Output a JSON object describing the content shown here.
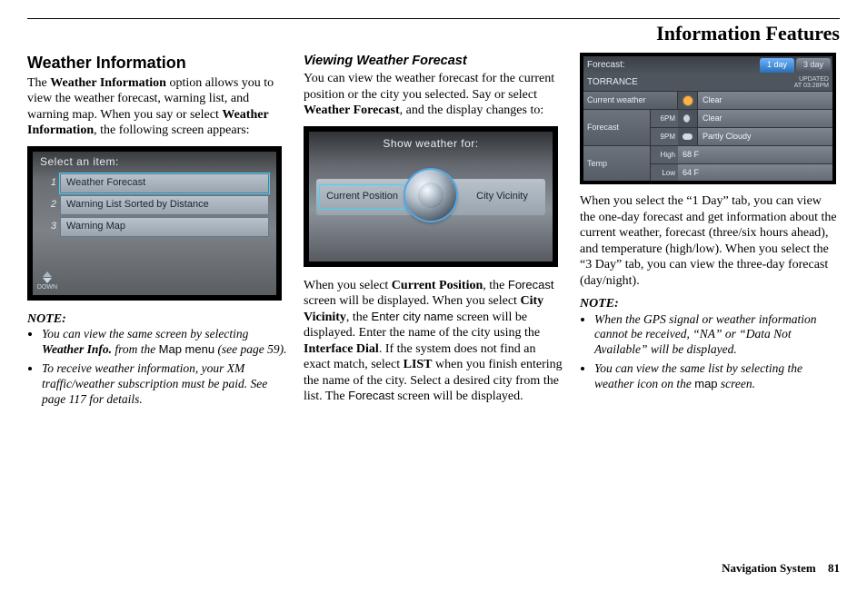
{
  "header": {
    "title": "Information Features"
  },
  "footer": {
    "label": "Navigation System",
    "page": "81"
  },
  "col1": {
    "heading": "Weather Information",
    "p1_a": "The ",
    "p1_b": "Weather Information",
    "p1_c": " option allows you to view the weather forecast, warning list, and warning map. When you say or select ",
    "p1_d": "Weather Information",
    "p1_e": ", the following screen appears:",
    "shot": {
      "title": "Select an item:",
      "r1": "Weather Forecast",
      "r2": "Warning List Sorted by Distance",
      "r3": "Warning Map",
      "down": "DOWN"
    },
    "note_label": "NOTE:",
    "notes": [
      {
        "a": "You can view the same screen by selecting ",
        "b": "Weather Info.",
        "c": " from the ",
        "d": "Map menu",
        "e": " (see page 59)."
      },
      {
        "a": "To receive weather information, your XM traffic/weather subscription must be paid. See page 117 for details."
      }
    ]
  },
  "col2": {
    "heading": "Viewing Weather Forecast",
    "p1_a": "You can view the weather forecast for the current position or the city you selected. Say or select ",
    "p1_b": "Weather Forecast",
    "p1_c": ", and the display changes to:",
    "shot": {
      "title": "Show weather for:",
      "left": "Current Position",
      "right": "City Vicinity"
    },
    "p2_a": "When you select ",
    "p2_b": "Current Position",
    "p2_c": ", the ",
    "p2_d": "Forecast",
    "p2_e": " screen will be displayed. When you select ",
    "p2_f": "City Vicinity",
    "p2_g": ", the ",
    "p2_h": "Enter city name",
    "p2_i": " screen will be displayed. Enter the name of the city using the ",
    "p2_j": "Interface Dial",
    "p2_k": ". If the system does not find an exact match, select ",
    "p2_l": "LIST",
    "p2_m": " when you finish entering the name of the city. Select a desired city from the list. The ",
    "p2_n": "Forecast",
    "p2_o": " screen will be displayed."
  },
  "col3": {
    "shot": {
      "title": "Forecast:",
      "tab1": "1 day",
      "tab2": "3 day",
      "city": "TORRANCE",
      "updated1": "UPDATED",
      "updated2": "AT 03:28PM",
      "row_cw_label": "Current weather",
      "row_cw_val": "Clear",
      "row_fc_label": "Forecast",
      "row_fc_t1": "6PM",
      "row_fc_v1": "Clear",
      "row_fc_t2": "9PM",
      "row_fc_v2": "Partly Cloudy",
      "row_tmp_label": "Temp",
      "row_tmp_h": "High",
      "row_tmp_hv": "68 F",
      "row_tmp_l": "Low",
      "row_tmp_lv": "64 F"
    },
    "p1": "When you select the “1 Day” tab, you can view the one-day forecast and get information about the current weather, forecast (three/six hours ahead), and temperature (high/low). When you select the “3 Day” tab, you can view the three-day forecast (day/night).",
    "note_label": "NOTE:",
    "notes": [
      {
        "a": "When the GPS signal or weather information cannot be received, “NA” or “Data Not Available” will be displayed."
      },
      {
        "a": "You can view the same list by selecting the weather icon on the ",
        "b": "map",
        "c": " screen."
      }
    ]
  },
  "chart_data": {
    "type": "table",
    "title": "Forecast: 1 day — TORRANCE (UPDATED AT 03:28PM)",
    "rows": [
      {
        "label": "Current weather",
        "value": "Clear"
      },
      {
        "label": "Forecast 6PM",
        "value": "Clear"
      },
      {
        "label": "Forecast 9PM",
        "value": "Partly Cloudy"
      },
      {
        "label": "Temp High",
        "value": "68 F"
      },
      {
        "label": "Temp Low",
        "value": "64 F"
      }
    ]
  }
}
